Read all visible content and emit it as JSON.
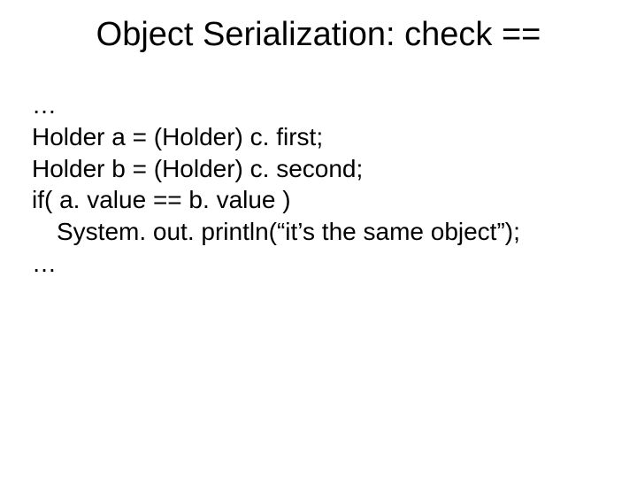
{
  "title": "Object Serialization: check ==",
  "body": {
    "lines": [
      "…",
      "Holder a = (Holder) c. first;",
      "Holder b = (Holder) c. second;",
      "if( a. value == b. value )"
    ],
    "indented": "System. out. println(“it’s the same object”);",
    "trailing": "…"
  }
}
